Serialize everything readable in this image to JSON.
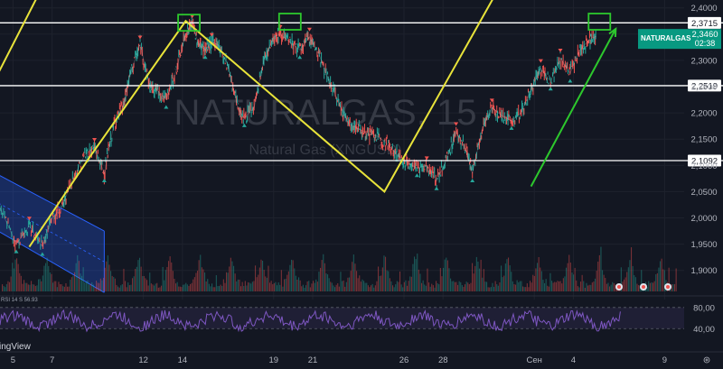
{
  "symbol": {
    "ticker": "NATURALGAS",
    "interval": "15",
    "name": "Natural Gas (XNGUSD)",
    "last_price": "2,3460",
    "countdown": "02:38"
  },
  "brand": "ingView",
  "chart_data": {
    "type": "line",
    "title": "",
    "price_axis": {
      "range": [
        1.86,
        2.415
      ],
      "ticks": [
        "2,4000",
        "2,3500",
        "2,3000",
        "2,2500",
        "2,2000",
        "2,1500",
        "2,1000",
        "2,0500",
        "2,0000",
        "1,9500",
        "1,9000"
      ],
      "tick_values": [
        2.4,
        2.35,
        2.3,
        2.25,
        2.2,
        2.15,
        2.1,
        2.05,
        2.0,
        1.95,
        1.9
      ]
    },
    "time_axis": {
      "ticks": [
        "5",
        "7",
        "12",
        "14",
        "19",
        "21",
        "26",
        "28",
        "Сен",
        "4",
        "9"
      ],
      "tick_index": [
        0.4,
        1.6,
        4.4,
        5.6,
        8.4,
        9.6,
        12.4,
        13.6,
        16.4,
        17.6,
        20.4
      ],
      "range": [
        0,
        21
      ]
    },
    "series": [
      {
        "values_x": [
          0.0,
          0.5,
          0.9,
          1.3,
          1.6,
          1.9,
          2.2,
          2.6,
          2.9,
          3.2,
          3.5,
          3.8,
          4.0,
          4.3,
          4.6,
          4.8,
          5.1,
          5.4,
          5.7,
          5.9,
          6.1,
          6.3,
          6.5,
          6.7,
          7.0,
          7.3,
          7.5,
          7.8,
          8.1,
          8.4,
          8.6,
          8.9,
          9.2,
          9.5,
          9.8,
          10.1,
          10.4,
          10.7,
          11.0,
          11.3,
          11.6,
          11.9,
          12.2,
          12.5,
          12.8,
          13.1,
          13.4,
          13.7,
          14.0,
          14.3,
          14.5,
          14.8,
          15.1,
          15.4,
          15.7,
          16.0,
          16.3,
          16.6,
          16.9,
          17.2,
          17.5,
          17.8,
          18.1,
          18.3
        ],
        "values_y": [
          2.02,
          1.95,
          1.985,
          1.945,
          2.0,
          2.02,
          2.07,
          2.12,
          2.135,
          2.085,
          2.18,
          2.215,
          2.275,
          2.33,
          2.25,
          2.245,
          2.225,
          2.28,
          2.35,
          2.37,
          2.33,
          2.32,
          2.335,
          2.33,
          2.29,
          2.21,
          2.19,
          2.21,
          2.3,
          2.345,
          2.35,
          2.335,
          2.32,
          2.345,
          2.31,
          2.26,
          2.22,
          2.18,
          2.17,
          2.16,
          2.155,
          2.14,
          2.12,
          2.105,
          2.095,
          2.1,
          2.07,
          2.11,
          2.165,
          2.13,
          2.085,
          2.17,
          2.21,
          2.195,
          2.185,
          2.2,
          2.245,
          2.285,
          2.26,
          2.305,
          2.275,
          2.32,
          2.34,
          2.346
        ]
      }
    ],
    "horizontal_levels": [
      {
        "value": 2.3715,
        "label": "2,3715"
      },
      {
        "value": 2.2519,
        "label": "2,2519"
      },
      {
        "value": 2.1092,
        "label": "2,1092"
      }
    ],
    "drawings": {
      "yellow_zigzag": {
        "x": [
          0.9,
          2.8,
          5.7,
          11.8,
          15.2
        ],
        "y": [
          1.945,
          2.12,
          2.375,
          2.05,
          2.425
        ]
      },
      "yellow_left_line": {
        "x": [
          -0.1,
          1.3
        ],
        "y": [
          2.27,
          2.44
        ]
      },
      "green_arrow": {
        "x": [
          16.3,
          18.9
        ],
        "y": [
          2.06,
          2.36
        ]
      },
      "green_boxes": [
        {
          "x": 5.8,
          "y": 2.37
        },
        {
          "x": 8.9,
          "y": 2.372
        },
        {
          "x": 18.4,
          "y": 2.372
        }
      ],
      "blue_channel": {
        "upper": [
          [
            -0.2,
            2.087
          ],
          [
            3.2,
            1.975
          ]
        ],
        "lower": [
          [
            -0.2,
            1.98
          ],
          [
            3.2,
            1.858
          ]
        ],
        "x_end": 3.2
      }
    },
    "volume": {
      "baseline_note": "volume histogram at bottom of price pane"
    },
    "rsi": {
      "label": "RSI 14 S  56.93",
      "levels": [
        "80,00",
        "40,00"
      ],
      "level_values": [
        80,
        40
      ],
      "range": [
        20,
        95
      ]
    },
    "colors": {
      "background": "#131722",
      "yellow": "#e8e33a",
      "green": "#2dc82d",
      "channel": "#2962ff",
      "rsi": "#7e57c2",
      "label_bg": "#ffffff",
      "price_tag": "#089981",
      "up_signal": "#26a69a",
      "down_signal": "#ef5350"
    }
  }
}
